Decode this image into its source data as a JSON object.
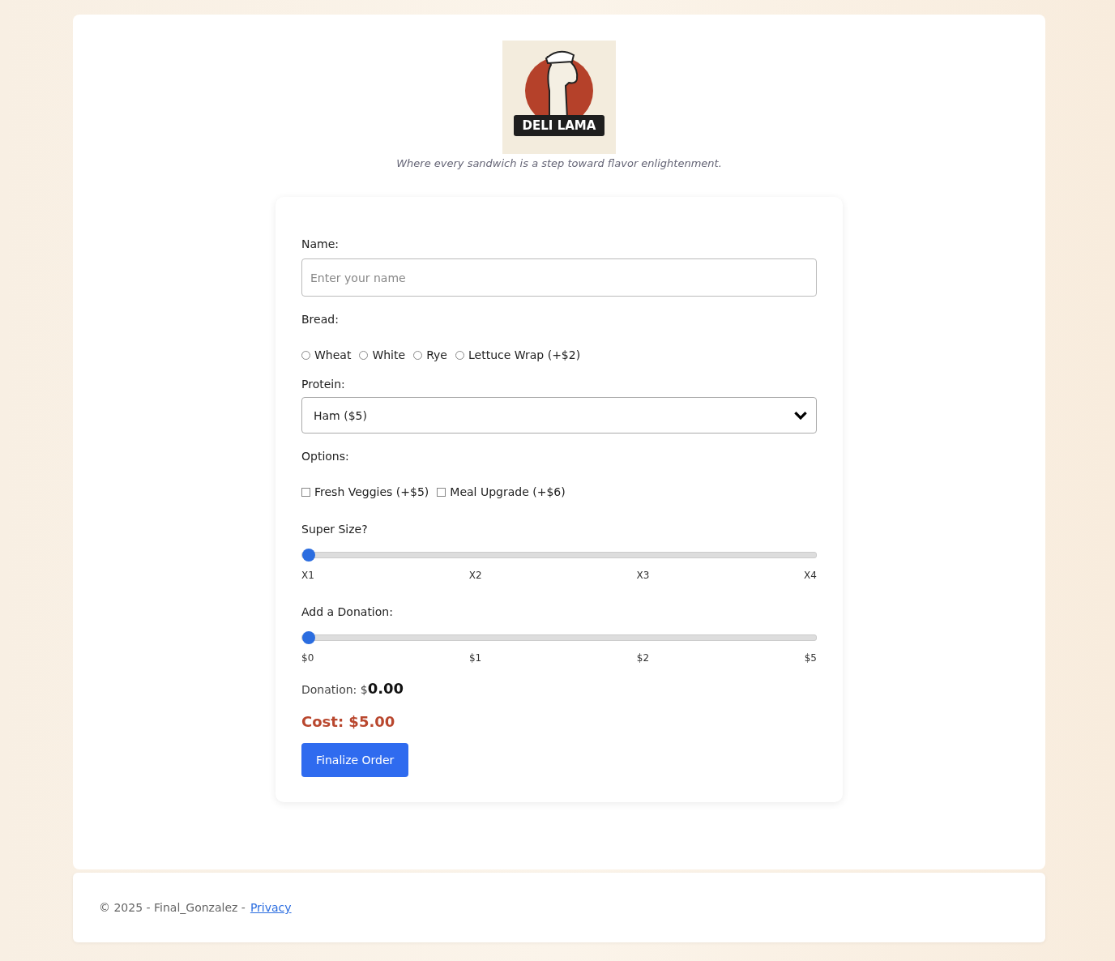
{
  "logo": {
    "text": "DELI LAMA"
  },
  "tagline": "Where every sandwich is a step toward flavor enlightenment.",
  "form": {
    "name": {
      "label": "Name:",
      "placeholder": "Enter your name"
    },
    "bread": {
      "label": "Bread:",
      "options": [
        {
          "label": "Wheat",
          "selected": false
        },
        {
          "label": "White",
          "selected": false
        },
        {
          "label": "Rye",
          "selected": false
        },
        {
          "label": "Lettuce Wrap (+$2)",
          "selected": false
        }
      ]
    },
    "protein": {
      "label": "Protein:",
      "value": "Ham ($5)"
    },
    "options": {
      "label": "Options:",
      "items": [
        {
          "label": "Fresh Veggies (+$5)",
          "checked": false
        },
        {
          "label": "Meal Upgrade (+$6)",
          "checked": false
        }
      ]
    },
    "sliders": [
      {
        "label": "Super Size?",
        "level": 0,
        "ticks": [
          "X1",
          "X2",
          "X3",
          "X4"
        ]
      },
      {
        "label": "Add a Donation:",
        "level": 0,
        "ticks": [
          "$0",
          "$1",
          "$2",
          "$5"
        ]
      }
    ],
    "donation": {
      "label": "Donation: $",
      "value": "0.00"
    },
    "cost": "Cost: $5.00",
    "submit": "Finalize Order"
  },
  "footer": {
    "text": "© 2025 - Final_Gonzalez -",
    "link": "Privacy"
  }
}
